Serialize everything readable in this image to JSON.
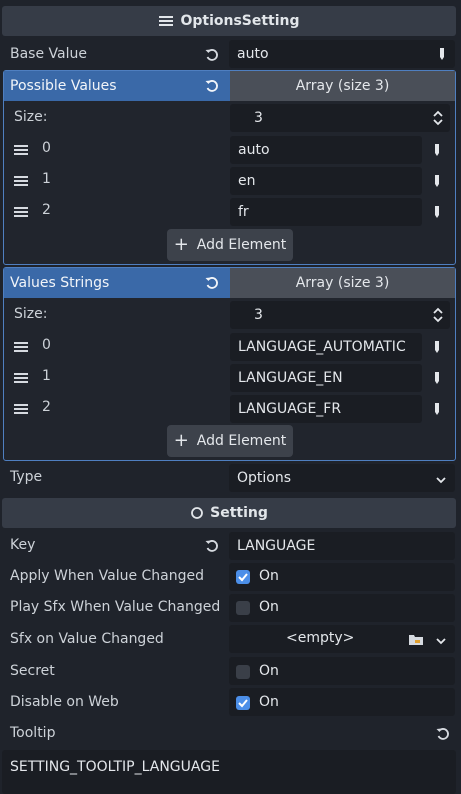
{
  "header": {
    "title": "OptionsSetting",
    "icon": "list-icon"
  },
  "base_value": {
    "label": "Base Value",
    "value": "auto"
  },
  "possible_values": {
    "label": "Possible Values",
    "array_label": "Array (size 3)",
    "size_label": "Size:",
    "size": "3",
    "items": [
      {
        "index": "0",
        "value": "auto"
      },
      {
        "index": "1",
        "value": "en"
      },
      {
        "index": "2",
        "value": "fr"
      }
    ],
    "add_label": "Add Element"
  },
  "values_strings": {
    "label": "Values Strings",
    "array_label": "Array (size 3)",
    "size_label": "Size:",
    "size": "3",
    "items": [
      {
        "index": "0",
        "value": "LANGUAGE_AUTOMATIC"
      },
      {
        "index": "1",
        "value": "LANGUAGE_EN"
      },
      {
        "index": "2",
        "value": "LANGUAGE_FR"
      }
    ],
    "add_label": "Add Element"
  },
  "type": {
    "label": "Type",
    "value": "Options"
  },
  "setting": {
    "title": "Setting",
    "icon": "circle-icon"
  },
  "key": {
    "label": "Key",
    "value": "LANGUAGE"
  },
  "apply_when_changed": {
    "label": "Apply When Value Changed",
    "checked": true,
    "text": "On"
  },
  "play_sfx": {
    "label": "Play Sfx When Value Changed",
    "checked": false,
    "text": "On"
  },
  "sfx": {
    "label": "Sfx on Value Changed",
    "value": "<empty>"
  },
  "secret": {
    "label": "Secret",
    "checked": false,
    "text": "On"
  },
  "disable_web": {
    "label": "Disable on Web",
    "checked": true,
    "text": "On"
  },
  "tooltip": {
    "label": "Tooltip",
    "value": "SETTING_TOOLTIP_LANGUAGE"
  },
  "colors": {
    "accent": "#3a69a8",
    "check": "#4c8fe8",
    "background": "#1f232b"
  }
}
